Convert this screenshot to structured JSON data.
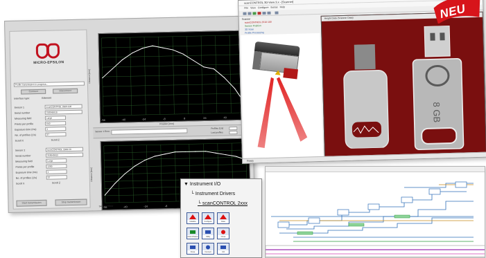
{
  "main_window": {
    "logo_text": "MICRO-EPSILON",
    "status_text": "Profile transmission in progress...",
    "btn_connect": "Connect",
    "btn_disconnect": "Disconnect",
    "interface_label": "Interface type:",
    "interface_value": "Ethernet",
    "sensor1": {
      "sensor_label": "Sensor 1",
      "sensor_value": "scanCONTROL 2900-100",
      "serial_label": "Serial number",
      "serial_value": "218040610",
      "mode_label": "Measuring field",
      "mode_value": "Large",
      "points_label": "Points per profile",
      "points_value": "640",
      "exposure_label": "Exposure time (ms)",
      "exposure_value": "1",
      "profiles_label": "No. of profiles (1/s)",
      "profiles_value": "37",
      "scroll_x_label": "Scroll X",
      "scroll_z_label": "Scroll Z"
    },
    "sensor2": {
      "sensor_label": "Sensor 2",
      "sensor_value": "scanCONTROL 2900-50",
      "serial_label": "Serial number",
      "serial_value": "218040615",
      "mode_label": "Measuring field",
      "mode_value": "Large",
      "points_label": "Points per profile",
      "points_value": "1280",
      "exposure_label": "Exposure time (ms)",
      "exposure_value": "1",
      "profiles_label": "No. of profiles (1/s)",
      "profiles_value": "37",
      "scroll_x_label": "Scroll X",
      "scroll_z_label": "Scroll Z"
    },
    "btn_start": "Start transmission",
    "btn_stop": "Stop transmission",
    "plot1_ylabel": "Distance [mm]",
    "plot1_xlabel": "Position [mm]",
    "plot2_ylabel": "Distance [mm]",
    "plot2_xlabel": "Position [mm]",
    "sensor1_err_label": "Sensor 1 Error",
    "sensor2_err_label": "Sensor 2 Error",
    "profiles1_label": "Profiles (1/s)",
    "lost_profiles_label": "Lost profiles"
  },
  "chart_data": [
    {
      "type": "line",
      "title": "",
      "xlabel": "Position [mm]",
      "ylabel": "Distance [mm]",
      "x": [
        -56,
        -48,
        -40,
        -32,
        -24,
        -16,
        -8,
        0,
        8,
        16,
        24,
        32,
        40,
        48,
        56
      ],
      "series": [
        {
          "values": [
            326,
            330,
            334,
            337,
            339,
            340,
            339,
            338,
            336,
            333,
            330,
            329,
            325,
            320,
            313
          ]
        }
      ],
      "grid": true
    },
    {
      "type": "line",
      "title": "",
      "xlabel": "Position [mm]",
      "ylabel": "Distance [mm]",
      "x": [
        -56,
        -48,
        -40,
        -32,
        -24,
        -16,
        -8,
        0,
        8,
        16,
        24,
        32,
        40,
        48,
        56
      ],
      "series": [
        {
          "values": [
            307,
            313,
            318,
            322,
            325,
            327,
            328,
            329,
            329,
            329,
            329,
            328,
            327,
            326,
            324
          ]
        }
      ],
      "grid": true
    }
  ],
  "viewer_window": {
    "title": "scanCONTROL 3D-View 3.x - [Scanner]",
    "menu": [
      "File",
      "View",
      "Configure",
      "Extras",
      "Help"
    ],
    "tree_items": [
      "Scanner",
      "scanCONTROL 2910-100",
      "Sensor Position",
      "3D Scan",
      "Profile Processing"
    ],
    "image_header": "Height Data (Scanner Data)",
    "status": "Ready"
  },
  "badge": {
    "text": "NEU",
    "color": "#d7141a"
  },
  "palette": {
    "line1": "Instrument I/O",
    "line2": "Instrument Drivers",
    "line3": "scanCONTROL 2xxx",
    "icons": [
      "Initialize",
      "Configure",
      "Data",
      "Action/Status",
      "Utility",
      "Close",
      "Close",
      "Connect",
      "Util"
    ]
  },
  "colors": {
    "plot_bg": "#000000",
    "plot_line": "#ffffff",
    "laser": "#e01919",
    "image_bg": "#7a0f0f"
  }
}
